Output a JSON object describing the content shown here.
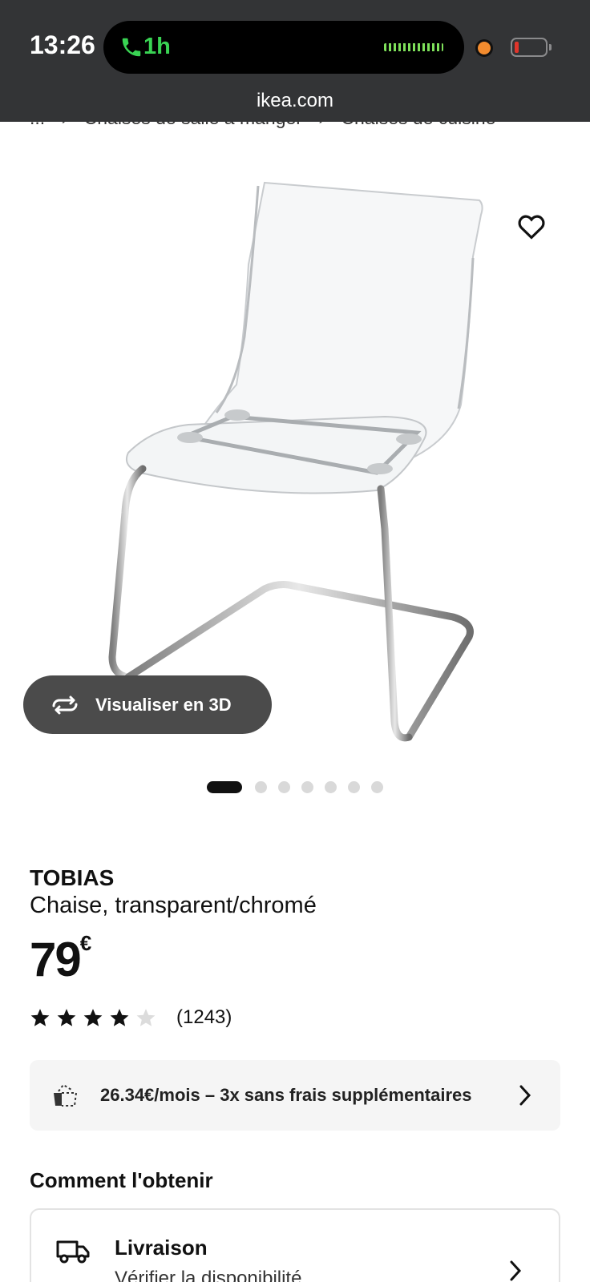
{
  "status_bar": {
    "time": "13:26",
    "call_duration": "1h",
    "url": "ikea.com"
  },
  "breadcrumb": [
    "...",
    "Chaises de salle à manger",
    "Chaises de cuisine"
  ],
  "product": {
    "name": "TOBIAS",
    "description": "Chaise, transparent/chromé",
    "price": "79",
    "currency": "€",
    "rating": 4,
    "rating_max": 5,
    "review_count": "(1243)",
    "view_3d_label": "Visualiser en 3D",
    "image_count": 7,
    "active_image": 1
  },
  "installment": {
    "text": "26.34€/mois – 3x sans frais supplémentaires"
  },
  "how_to_get": {
    "title": "Comment l'obtenir",
    "delivery_title": "Livraison",
    "delivery_sub": "Vérifier la disponibilité"
  },
  "colors": {
    "status_bar_bg": "#333436",
    "call_green": "#39d353",
    "button_3d_bg": "#4b4b4b",
    "installment_bg": "#f5f5f5"
  },
  "icons": [
    "phone-icon",
    "heart-icon",
    "rotate-3d-icon",
    "star-icon",
    "installment-icon",
    "chevron-right-icon",
    "truck-icon"
  ]
}
